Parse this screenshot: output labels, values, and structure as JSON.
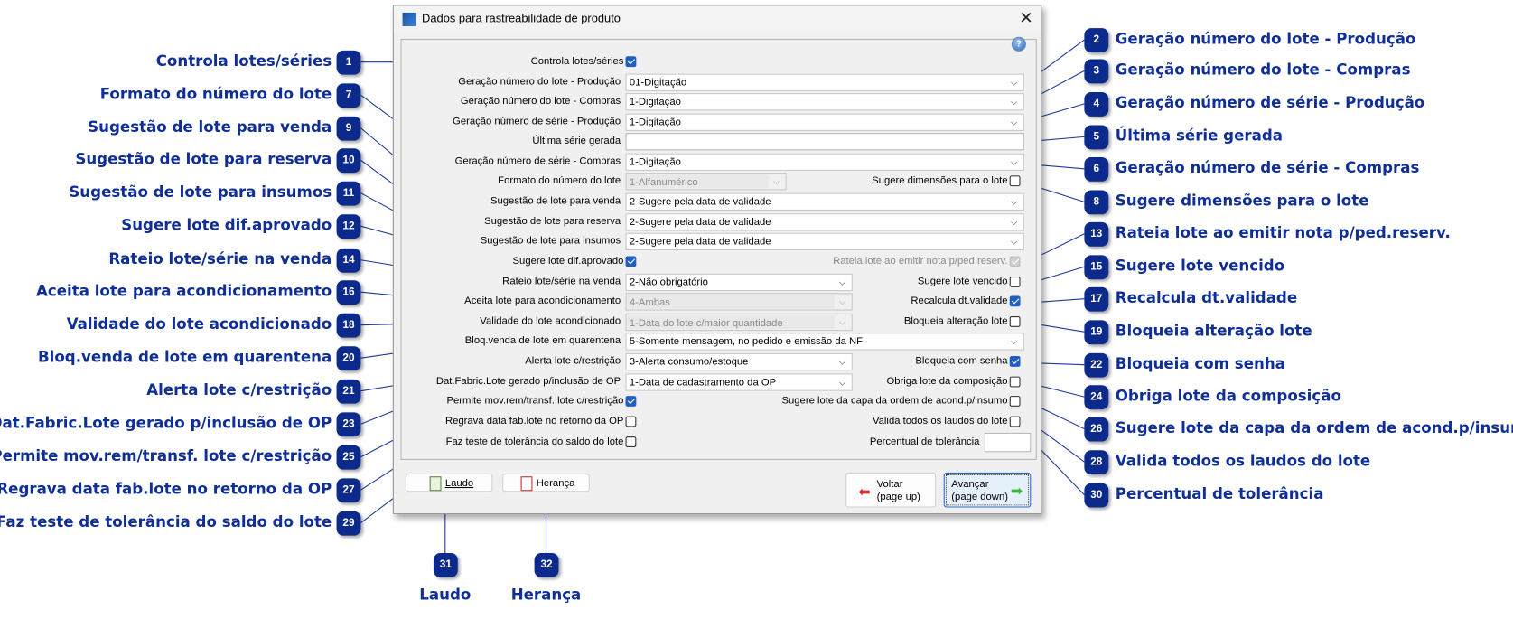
{
  "window": {
    "title": "Dados para rastreabilidade de produto",
    "close_icon": "close-icon",
    "help_icon": "help-icon",
    "help_text": "?"
  },
  "form": {
    "rows": [
      {
        "label": "Controla lotes/séries",
        "type": "checkbox",
        "checked": true
      },
      {
        "label": "Geração número do lote - Produção",
        "type": "combo",
        "value": "01-Digitação",
        "width": "full"
      },
      {
        "label": "Geração número do lote - Compras",
        "type": "combo",
        "value": "1-Digitação",
        "width": "full"
      },
      {
        "label": "Geração número de série - Produção",
        "type": "combo",
        "value": "1-Digitação",
        "width": "full"
      },
      {
        "label": "Última série gerada",
        "type": "text",
        "value": ""
      },
      {
        "label": "Geração número de série - Compras",
        "type": "combo",
        "value": "1-Digitação",
        "width": "full"
      },
      {
        "label": "Formato do número do lote",
        "type": "combo",
        "value": "1-Alfanumérico",
        "width": "short",
        "disabled": true,
        "right": {
          "label": "Sugere dimensões para o lote",
          "checked": false
        }
      },
      {
        "label": "Sugestão de lote para venda",
        "type": "combo",
        "value": "2-Sugere pela data de validade",
        "width": "full"
      },
      {
        "label": "Sugestão de lote para reserva",
        "type": "combo",
        "value": "2-Sugere pela data de validade",
        "width": "full"
      },
      {
        "label": "Sugestão de lote para insumos",
        "type": "combo",
        "value": "2-Sugere pela data de validade",
        "width": "full"
      },
      {
        "label": "Sugere lote dif.aprovado",
        "type": "checkbox",
        "checked": true,
        "right": {
          "label": "Rateia lote ao emitir nota p/ped.reserv.",
          "checked": true,
          "disabled": true
        }
      },
      {
        "label": "Rateio lote/série na venda",
        "type": "combo",
        "value": "2-Não obrigatório",
        "width": "half",
        "right": {
          "label": "Sugere lote vencido",
          "checked": false
        }
      },
      {
        "label": "Aceita lote para acondicionamento",
        "type": "combo",
        "value": "4-Ambas",
        "width": "half",
        "disabled": true,
        "right": {
          "label": "Recalcula dt.validade",
          "checked": true
        }
      },
      {
        "label": "Validade do lote acondicionado",
        "type": "combo",
        "value": "1-Data do lote c/maior quantidade",
        "width": "half",
        "disabled": true,
        "right": {
          "label": "Bloqueia alteração lote",
          "checked": false
        }
      },
      {
        "label": "Bloq.venda de lote em quarentena",
        "type": "combo",
        "value": "5-Somente mensagem, no pedido e emissão da NF",
        "width": "full"
      },
      {
        "label": "Alerta lote c/restrição",
        "type": "combo",
        "value": "3-Alerta consumo/estoque",
        "width": "half",
        "right": {
          "label": "Bloqueia com senha",
          "checked": true
        }
      },
      {
        "label": "Dat.Fabric.Lote gerado p/inclusão de OP",
        "type": "combo",
        "value": "1-Data de cadastramento da OP",
        "width": "half",
        "right": {
          "label": "Obriga lote da composição",
          "checked": false
        }
      },
      {
        "label": "Permite mov.rem/transf. lote c/restrição",
        "type": "checkbox",
        "checked": true,
        "right": {
          "label": "Sugere lote da capa da ordem de acond.p/insumo",
          "checked": false
        }
      },
      {
        "label": "Regrava data fab.lote no retorno da OP",
        "type": "checkbox",
        "checked": false,
        "right": {
          "label": "Valida todos os laudos do lote",
          "checked": false
        }
      },
      {
        "label": "Faz teste de tolerância do saldo do lote",
        "type": "checkbox",
        "checked": false,
        "right": {
          "label": "Percentual de tolerância",
          "type": "text",
          "value": ""
        }
      }
    ]
  },
  "buttons": {
    "laudo": {
      "label": "Laudo",
      "icon": "report-icon"
    },
    "heranca": {
      "label": "Herança",
      "icon": "checklist-icon"
    },
    "voltar": {
      "label": "Voltar\n(page up)",
      "icon": "arrow-left-icon"
    },
    "avancar": {
      "label": "Avançar\n(page down)",
      "icon": "arrow-right-icon"
    }
  },
  "callouts": {
    "color": "#0b2a8c",
    "left": [
      {
        "n": "1",
        "label": "Controla lotes/séries"
      },
      {
        "n": "7",
        "label": "Formato do número do lote"
      },
      {
        "n": "9",
        "label": "Sugestão de lote para venda"
      },
      {
        "n": "10",
        "label": "Sugestão de lote para reserva"
      },
      {
        "n": "11",
        "label": "Sugestão de lote para insumos"
      },
      {
        "n": "12",
        "label": "Sugere lote dif.aprovado"
      },
      {
        "n": "14",
        "label": "Rateio lote/série na venda"
      },
      {
        "n": "16",
        "label": "Aceita lote para acondicionamento"
      },
      {
        "n": "18",
        "label": "Validade do lote acondicionado"
      },
      {
        "n": "20",
        "label": "Bloq.venda de lote em quarentena"
      },
      {
        "n": "21",
        "label": "Alerta lote c/restrição"
      },
      {
        "n": "23",
        "label": "Dat.Fabric.Lote gerado p/inclusão de OP"
      },
      {
        "n": "25",
        "label": "Permite mov.rem/transf. lote c/restrição"
      },
      {
        "n": "27",
        "label": "Regrava data fab.lote no retorno da OP"
      },
      {
        "n": "29",
        "label": "Faz teste de tolerância do saldo do lote"
      }
    ],
    "right": [
      {
        "n": "2",
        "label": "Geração número do lote - Produção"
      },
      {
        "n": "3",
        "label": "Geração número do lote - Compras"
      },
      {
        "n": "4",
        "label": "Geração número de série - Produção"
      },
      {
        "n": "5",
        "label": "Última série gerada"
      },
      {
        "n": "6",
        "label": "Geração número de série - Compras"
      },
      {
        "n": "8",
        "label": "Sugere dimensões para o lote"
      },
      {
        "n": "13",
        "label": "Rateia lote ao emitir nota p/ped.reserv."
      },
      {
        "n": "15",
        "label": "Sugere lote vencido"
      },
      {
        "n": "17",
        "label": "Recalcula dt.validade"
      },
      {
        "n": "19",
        "label": "Bloqueia alteração lote"
      },
      {
        "n": "22",
        "label": "Bloqueia com senha"
      },
      {
        "n": "24",
        "label": "Obriga lote da composição"
      },
      {
        "n": "26",
        "label": "Sugere lote da capa da ordem de acond.p/insumo"
      },
      {
        "n": "28",
        "label": "Valida todos os laudos do lote"
      },
      {
        "n": "30",
        "label": "Percentual de tolerância"
      }
    ],
    "bottom": [
      {
        "n": "31",
        "label": "Laudo"
      },
      {
        "n": "32",
        "label": "Herança"
      }
    ]
  }
}
